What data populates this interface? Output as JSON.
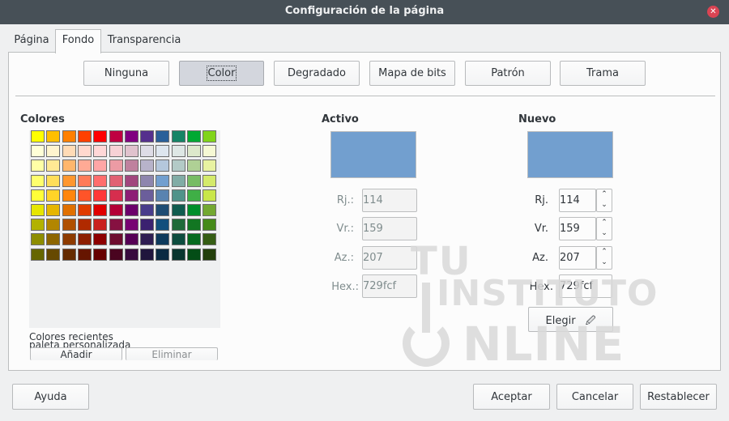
{
  "window": {
    "title": "Configuración de la página"
  },
  "tabs": [
    {
      "label": "Página"
    },
    {
      "label": "Fondo"
    },
    {
      "label": "Transparencia"
    }
  ],
  "fill_buttons": [
    {
      "label": "Ninguna"
    },
    {
      "label": "Color"
    },
    {
      "label": "Degradado"
    },
    {
      "label": "Mapa de bits"
    },
    {
      "label": "Patrón"
    },
    {
      "label": "Trama"
    }
  ],
  "colors": {
    "title": "Colores",
    "recent_label": "Colores recientes",
    "custom_label": "paleta personalizada",
    "add_label": "Añadir",
    "delete_label": "Eliminar",
    "palette": [
      [
        "#ffff00",
        "#ffbf00",
        "#ff8000",
        "#ff4000",
        "#ff0000",
        "#bf0041",
        "#800080",
        "#55308d",
        "#2a6099",
        "#158466",
        "#00a933",
        "#81d41a"
      ],
      [
        "#ffffd7",
        "#fff5ce",
        "#ffdbb6",
        "#ffd8ce",
        "#ffd7d7",
        "#f7d1d5",
        "#e0c2cd",
        "#dedce6",
        "#dee6ef",
        "#dee7e5",
        "#dde8cb",
        "#f6f9d4"
      ],
      [
        "#ffffa6",
        "#ffe994",
        "#ffb66c",
        "#ffaa95",
        "#ffa6a6",
        "#ec9ba4",
        "#bf819e",
        "#b7b3ca",
        "#b4c7dc",
        "#b3cac7",
        "#afd095",
        "#e8f2a1"
      ],
      [
        "#ffff6d",
        "#ffde59",
        "#ff972f",
        "#ff7b59",
        "#ff6d6d",
        "#e16173",
        "#a1467e",
        "#8e86ae",
        "#729fcf",
        "#81aca6",
        "#77bc65",
        "#d4ea6b"
      ],
      [
        "#ffff38",
        "#ffd428",
        "#ff860d",
        "#ff5429",
        "#ff3838",
        "#d62e4e",
        "#8d1d75",
        "#6b5e9b",
        "#5983b0",
        "#50938a",
        "#3faf46",
        "#c9e64a"
      ],
      [
        "#e6e600",
        "#e6b600",
        "#e07000",
        "#e03c00",
        "#e00000",
        "#b30037",
        "#6b006b",
        "#483d8b",
        "#1e4c73",
        "#105b4f",
        "#008e2b",
        "#73a832"
      ],
      [
        "#b2b200",
        "#b28600",
        "#b05000",
        "#b02a00",
        "#c9211e",
        "#861141",
        "#780373",
        "#3b2170",
        "#124f7d",
        "#1e6a39",
        "#127622",
        "#468a1a"
      ],
      [
        "#8d8d00",
        "#8d6600",
        "#8d3b00",
        "#8d1e00",
        "#8d0000",
        "#6d0d2f",
        "#550055",
        "#2f1e52",
        "#0e3a5c",
        "#0d4c3f",
        "#066a1f",
        "#355d14"
      ],
      [
        "#666600",
        "#664900",
        "#662b00",
        "#661500",
        "#660000",
        "#4a0420",
        "#380a3e",
        "#20153d",
        "#0a2a43",
        "#083630",
        "#034d16",
        "#233f0c"
      ]
    ]
  },
  "active": {
    "title": "Activo",
    "color": "#729fcf",
    "r_label": "Rj.:",
    "r_value": "114",
    "g_label": "Vr.:",
    "g_value": "159",
    "b_label": "Az.:",
    "b_value": "207",
    "hex_label": "Hex.:",
    "hex_value": "729fcf"
  },
  "new": {
    "title": "Nuevo",
    "color": "#729fcf",
    "r_label": "Rj.",
    "r_value": "114",
    "g_label": "Vr.",
    "g_value": "159",
    "b_label": "Az.",
    "b_value": "207",
    "hex_label": "Hex.",
    "hex_value": "729fcf",
    "pick_label": "Elegir"
  },
  "watermark": {
    "line1": "TU",
    "line2": "INSTITUTO",
    "line3": "NLINE"
  },
  "footer": {
    "help": "Ayuda",
    "ok": "Aceptar",
    "cancel": "Cancelar",
    "reset": "Restablecer"
  }
}
